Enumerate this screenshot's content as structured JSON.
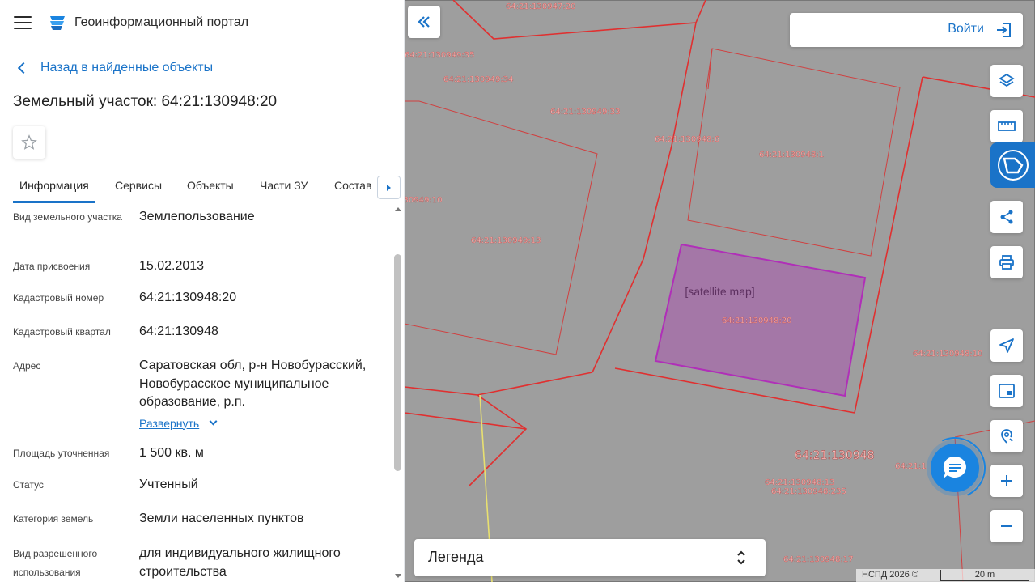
{
  "app": {
    "title": "Геоинформационный портал"
  },
  "nav": {
    "back_label": "Назад в найденные объекты"
  },
  "page": {
    "title": "Земельный участок: 64:21:130948:20"
  },
  "tabs": [
    {
      "label": "Информация",
      "active": true
    },
    {
      "label": "Сервисы"
    },
    {
      "label": "Объекты"
    },
    {
      "label": "Части ЗУ"
    },
    {
      "label": "Состав"
    }
  ],
  "info": [
    {
      "label": "Вид земельного участка",
      "value": "Землепользование"
    },
    {
      "label": "Дата присвоения",
      "value": "15.02.2013"
    },
    {
      "label": "Кадастровый номер",
      "value": "64:21:130948:20"
    },
    {
      "label": "Кадастровый квартал",
      "value": "64:21:130948"
    },
    {
      "label": "Адрес",
      "value": "Саратовская обл, р-н Новобурасский, Новобурасское муниципальное образование, р.п.",
      "expand_label": "Развернуть"
    },
    {
      "label": "Площадь уточненная",
      "value": "1 500 кв. м"
    },
    {
      "label": "Статус",
      "value": "Учтенный"
    },
    {
      "label": "Категория земель",
      "value": "Земли населенных пунктов"
    },
    {
      "label": "Вид разрешенного использования",
      "value": "для индивидуального жилищного строительства"
    }
  ],
  "map": {
    "image_alt": "[satellite map]",
    "login_label": "Войти",
    "legend_label": "Легенда",
    "attribution": "НСПД 2026 ©",
    "scale_label": "20 m",
    "parcel_labels": [
      "64:21:130947:20",
      "64:21:130949:35",
      "64:21:130949:34",
      "64:21:130949:33",
      "64:21:130948:6",
      "64:21:130948:1",
      "64:21:130949:10",
      "64:21:130949:13",
      "64:21:130948:20",
      "64:21:130948:10",
      "64:21:130948",
      "64:21:130948:13",
      "64:21:130948:235",
      "64:21:1",
      "64:21:130948:17"
    ],
    "accent_color": "#1a73c8",
    "selected_parcel_color": "#b02fb8"
  }
}
